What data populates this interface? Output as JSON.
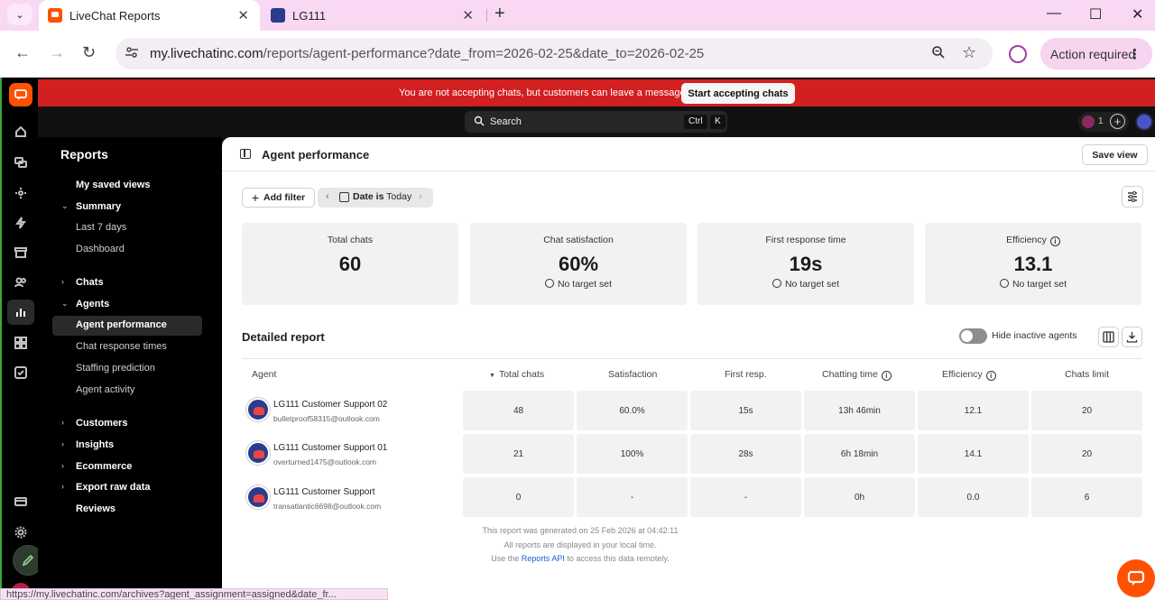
{
  "browser": {
    "tabs": [
      {
        "title": "LiveChat Reports",
        "icon": "livechat-icon"
      },
      {
        "title": "LG111",
        "icon": "lg111-icon"
      }
    ],
    "url_host": "my.livechatinc.com",
    "url_path": "/reports/agent-performance?date_from=2026-02-25&date_to=2026-02-25",
    "action_label": "Action required",
    "status_url": "https://my.livechatinc.com/archives?agent_assignment=assigned&date_fr..."
  },
  "banner": {
    "message": "You are not accepting chats, but customers can leave a message.",
    "button": "Start accepting chats"
  },
  "topbar": {
    "search_label": "Search",
    "kbd_1": "Ctrl",
    "kbd_2": "K",
    "badge_count": "1"
  },
  "sidebar": {
    "title": "Reports",
    "items": {
      "saved_views": "My saved views",
      "summary": "Summary",
      "last7": "Last 7 days",
      "dashboard": "Dashboard",
      "chats": "Chats",
      "agents": "Agents",
      "agent_performance": "Agent performance",
      "chat_response": "Chat response times",
      "staffing": "Staffing prediction",
      "agent_activity": "Agent activity",
      "customers": "Customers",
      "insights": "Insights",
      "ecommerce": "Ecommerce",
      "export": "Export raw data",
      "reviews": "Reviews"
    }
  },
  "main": {
    "title": "Agent performance",
    "save_view": "Save view",
    "add_filter": "Add filter",
    "filter_bold": "Date is",
    "filter_value": "Today",
    "kpis": [
      {
        "label": "Total chats",
        "value": "60",
        "target": ""
      },
      {
        "label": "Chat satisfaction",
        "value": "60%",
        "target": "No target set"
      },
      {
        "label": "First response time",
        "value": "19s",
        "target": "No target set"
      },
      {
        "label": "Efficiency",
        "value": "13.1",
        "target": "No target set"
      }
    ],
    "detailed_title": "Detailed report",
    "hide_inactive": "Hide inactive agents",
    "columns": [
      "Agent",
      "Total chats",
      "Satisfaction",
      "First resp.",
      "Chatting time",
      "Efficiency",
      "Chats limit"
    ],
    "rows": [
      {
        "name": "LG111 Customer Support 02",
        "email": "bulletproof58315@outlook.com",
        "cells": [
          "48",
          "60.0%",
          "15s",
          "13h 46min",
          "12.1",
          "20"
        ]
      },
      {
        "name": "LG111 Customer Support 01",
        "email": "overturned1475@outlook.com",
        "cells": [
          "21",
          "100%",
          "28s",
          "6h 18min",
          "14.1",
          "20"
        ]
      },
      {
        "name": "LG111 Customer Support",
        "email": "transatlantic6698@outlook.com",
        "cells": [
          "0",
          "-",
          "-",
          "0h",
          "0.0",
          "6"
        ]
      }
    ],
    "footer": {
      "generated": "This report was generated on 25 Feb 2026 at 04:42:11",
      "local": "All reports are displayed in your local time.",
      "api_pre": "Use the",
      "api_link": "Reports API",
      "api_post": "to access this data remotely."
    }
  },
  "colors": {
    "banner": "#d21f1f",
    "brand": "#ff5100",
    "link": "#1f5bd8"
  }
}
